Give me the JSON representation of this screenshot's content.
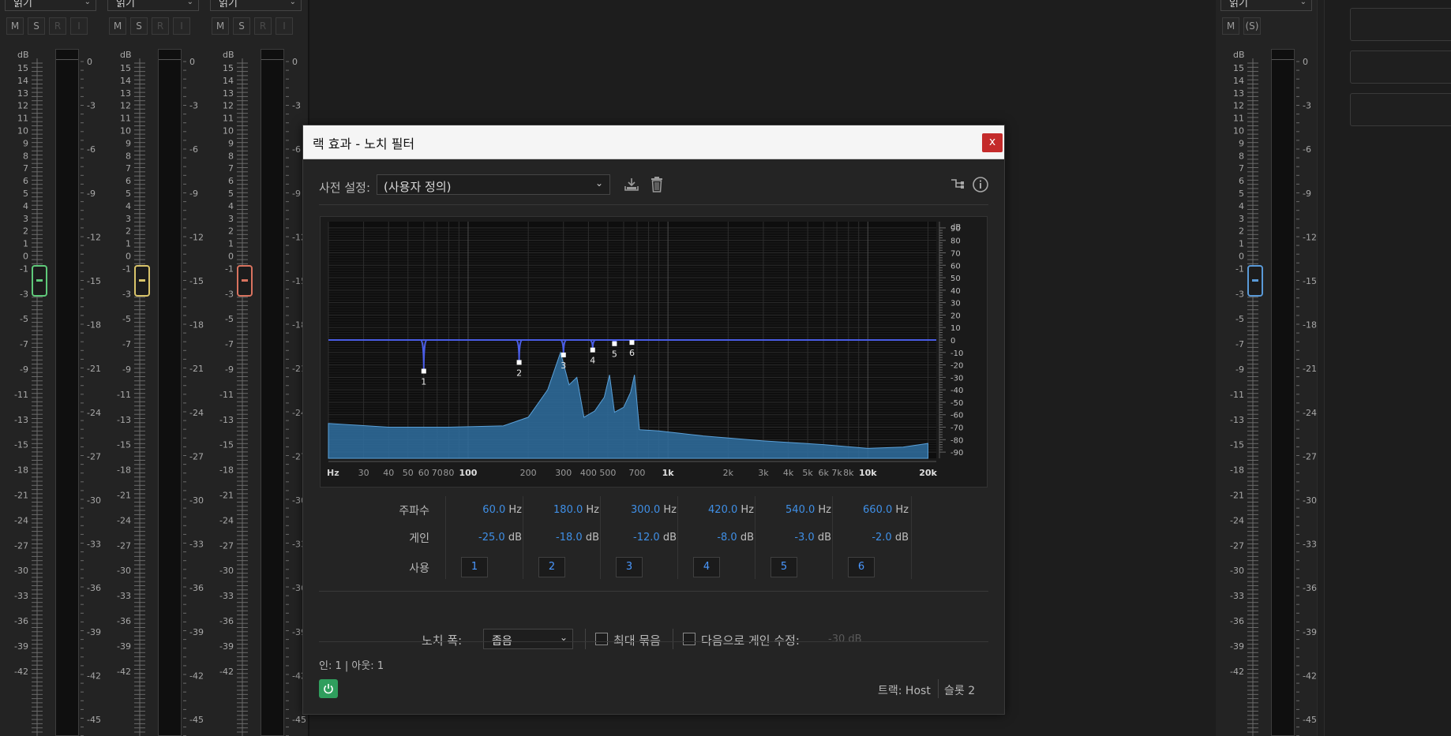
{
  "mixer": {
    "strips": [
      {
        "mode": "읽기",
        "buttons": [
          "M",
          "S",
          "R",
          "I"
        ],
        "knob_color": "#5fc97a"
      },
      {
        "mode": "읽기",
        "buttons": [
          "M",
          "S",
          "R",
          "I"
        ],
        "knob_color": "#d9c46a"
      },
      {
        "mode": "읽기",
        "buttons": [
          "M",
          "S",
          "R",
          "I"
        ],
        "knob_color": "#d9735f"
      },
      {
        "mode": "읽기",
        "buttons": [
          "M",
          "(S)"
        ],
        "knob_color": "#5a9ad8"
      }
    ],
    "fader_db_label": "dB",
    "fader_scale": [
      "15",
      "14",
      "13",
      "12",
      "11",
      "10",
      "9",
      "8",
      "7",
      "6",
      "5",
      "4",
      "3",
      "2",
      "1",
      "0",
      "-1",
      "-3",
      "-5",
      "-7",
      "-9",
      "-11",
      "-13",
      "-15",
      "-18",
      "-21",
      "-24",
      "-27",
      "-30",
      "-33",
      "-36",
      "-39",
      "-42"
    ],
    "meter_scale": [
      "0",
      "-3",
      "-6",
      "-9",
      "-12",
      "-15",
      "-18",
      "-21",
      "-24",
      "-27",
      "-30",
      "-33",
      "-36",
      "-39",
      "-42",
      "-45"
    ]
  },
  "dialog": {
    "title": "랙 효과 - 노치 필터",
    "close_label": "x",
    "preset_label": "사전 설정:",
    "preset_value": "(사용자 정의)",
    "icons": [
      "save-preset-icon",
      "delete-preset-icon",
      "routing-icon",
      "info-icon"
    ],
    "param_labels": {
      "freq": "주파수",
      "gain": "게인",
      "use": "사용"
    },
    "bands": [
      {
        "freq": "60.0",
        "gain": "-25.0",
        "use": "1"
      },
      {
        "freq": "180.0",
        "gain": "-18.0",
        "use": "2"
      },
      {
        "freq": "300.0",
        "gain": "-12.0",
        "use": "3"
      },
      {
        "freq": "420.0",
        "gain": "-8.0",
        "use": "4"
      },
      {
        "freq": "540.0",
        "gain": "-3.0",
        "use": "5"
      },
      {
        "freq": "660.0",
        "gain": "-2.0",
        "use": "6"
      }
    ],
    "freq_unit": "Hz",
    "gain_unit": "dB",
    "notch_width_label": "노치 폭:",
    "notch_width_value": "좁음",
    "max_group_label": "최대 묶음",
    "gain_fix_label": "다음으로 게인 수정:",
    "gain_fix_value": "-30 dB",
    "io_label": "인: 1 | 아웃: 1",
    "track_label": "트랙: Host",
    "slot_label": "슬롯 2"
  },
  "chart_data": {
    "type": "line",
    "title": "",
    "xlabel": "Hz",
    "ylabel": "dB",
    "x_scale": "log",
    "xlim": [
      20,
      22000
    ],
    "ylim": [
      -95,
      95
    ],
    "x_ticks": [
      "30",
      "40",
      "50",
      "60",
      "70",
      "80",
      "100",
      "200",
      "300",
      "400",
      "500",
      "700",
      "1k",
      "2k",
      "3k",
      "4k",
      "5k",
      "6k",
      "7k",
      "8k",
      "10k",
      "20k"
    ],
    "y_ticks": [
      "90",
      "80",
      "70",
      "60",
      "50",
      "40",
      "30",
      "20",
      "10",
      "0",
      "-10",
      "-20",
      "-30",
      "-40",
      "-50",
      "-60",
      "-70",
      "-80",
      "-90"
    ],
    "series": [
      {
        "name": "",
        "kind": "filter-response",
        "color": "#4a5de6",
        "points": [
          [
            60,
            -25
          ],
          [
            180,
            -18
          ],
          [
            300,
            -12
          ],
          [
            420,
            -8
          ],
          [
            540,
            -3
          ],
          [
            660,
            -2
          ]
        ],
        "handles": [
          "1",
          "2",
          "3",
          "4",
          "5",
          "6"
        ]
      },
      {
        "name": "",
        "kind": "spectrum",
        "color": "#3a7ab0",
        "x": [
          20,
          40,
          80,
          150,
          200,
          250,
          290,
          320,
          350,
          380,
          430,
          480,
          510,
          540,
          600,
          650,
          680,
          720,
          900,
          1500,
          3000,
          6000,
          10000,
          15000,
          20000
        ],
        "y": [
          -67,
          -70,
          -70,
          -69,
          -62,
          -40,
          -10,
          -36,
          -30,
          -62,
          -57,
          -46,
          -28,
          -58,
          -54,
          -42,
          -28,
          -72,
          -73,
          -77,
          -81,
          -84,
          -87,
          -86,
          -83
        ]
      }
    ],
    "grid": true
  }
}
